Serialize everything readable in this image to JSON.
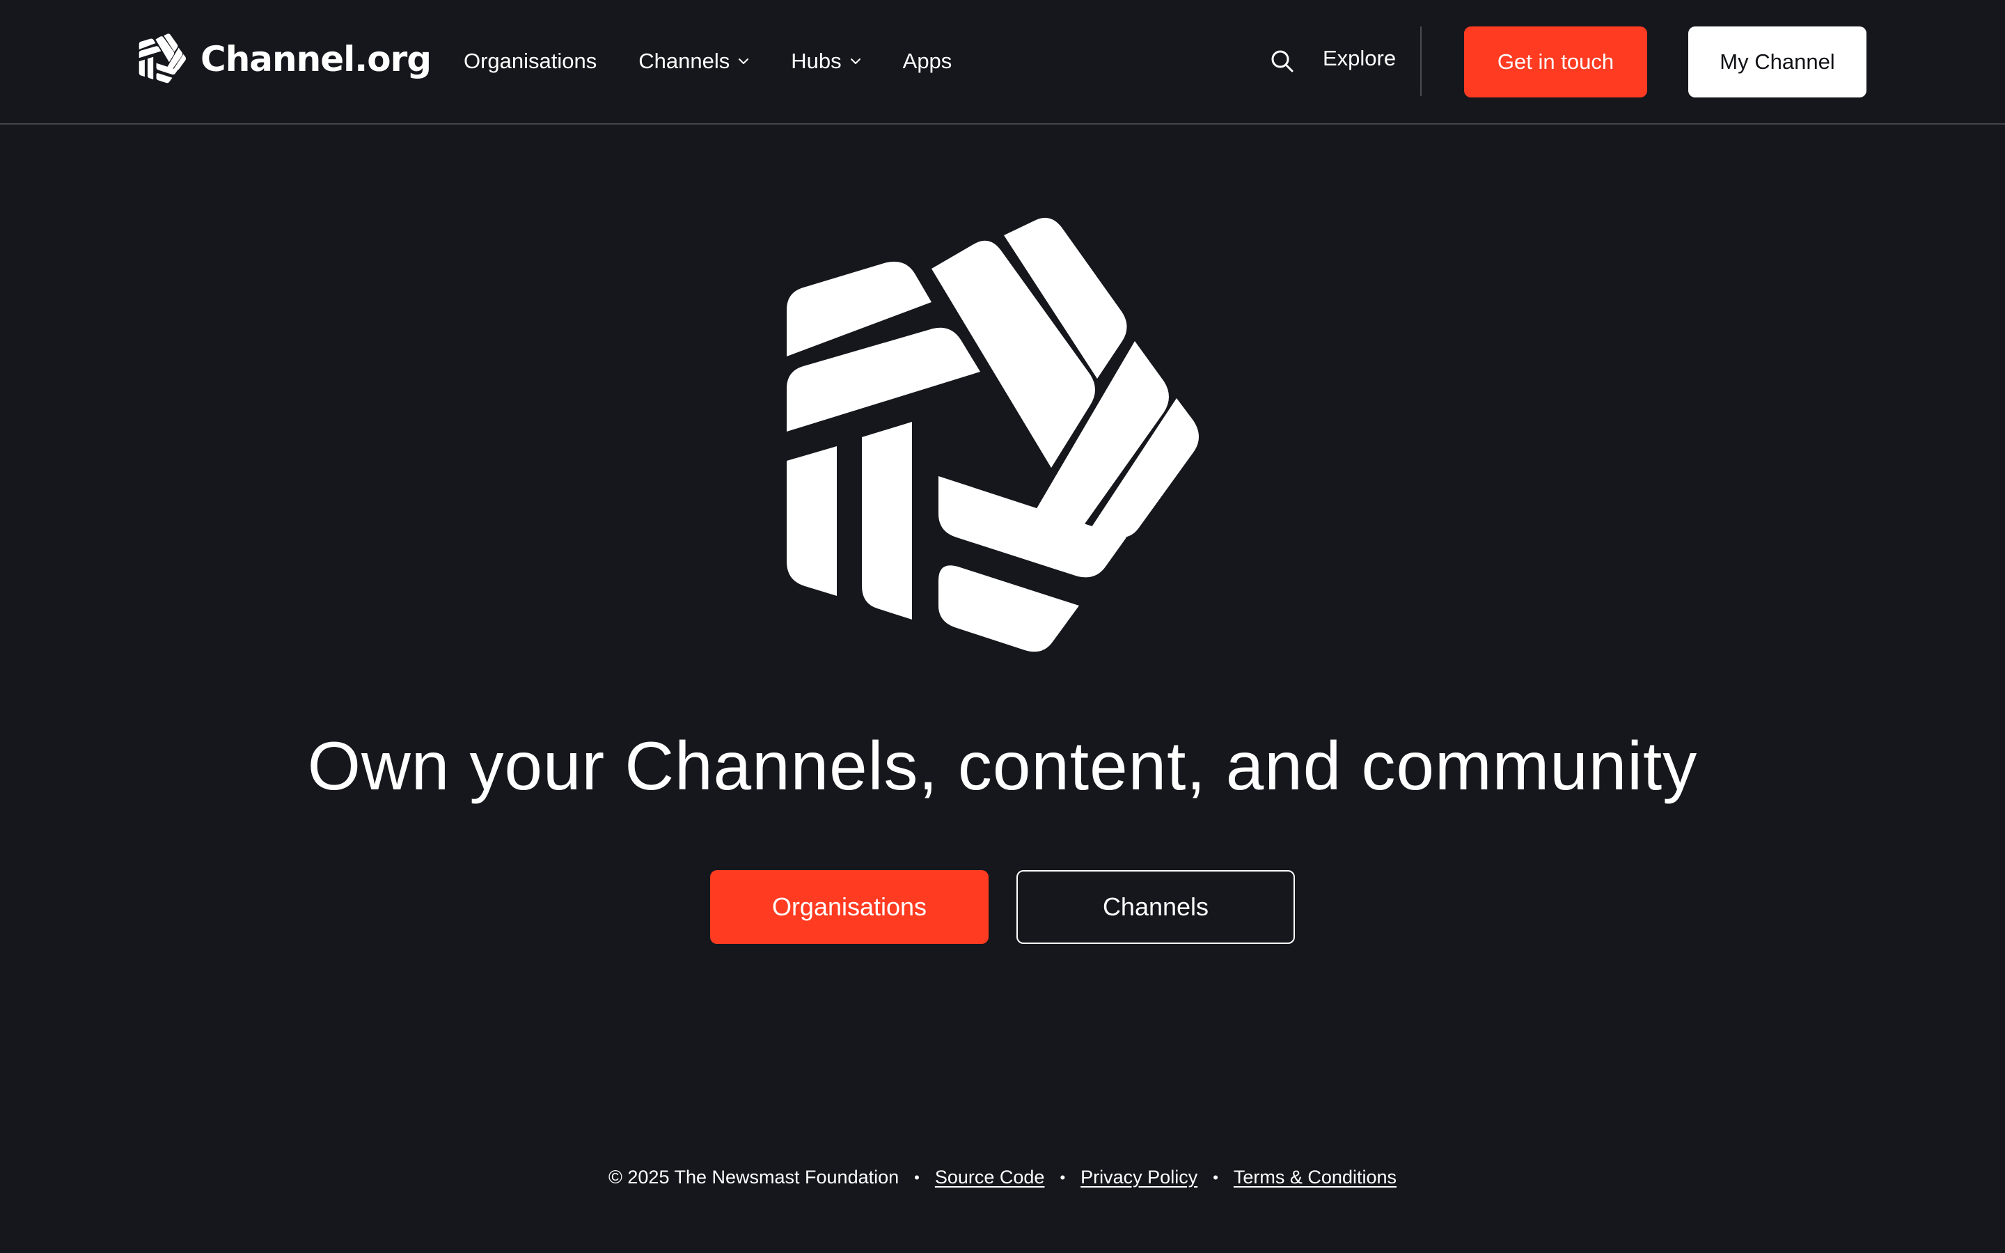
{
  "brand": {
    "name": "Channel.org"
  },
  "nav": {
    "organisations": "Organisations",
    "channels": "Channels",
    "hubs": "Hubs",
    "apps": "Apps"
  },
  "header_actions": {
    "search_icon": "search-icon",
    "explore": "Explore",
    "get_in_touch": "Get in touch",
    "my_channel": "My Channel"
  },
  "hero": {
    "headline": "Own your Channels, content, and community",
    "primary_cta": "Organisations",
    "secondary_cta": "Channels"
  },
  "footer": {
    "copyright": "© 2025 The Newsmast Foundation",
    "source_code": "Source Code",
    "privacy_policy": "Privacy Policy",
    "terms": "Terms & Conditions"
  },
  "colors": {
    "background": "#16171c",
    "accent": "#ff3b22",
    "text": "#ffffff"
  }
}
